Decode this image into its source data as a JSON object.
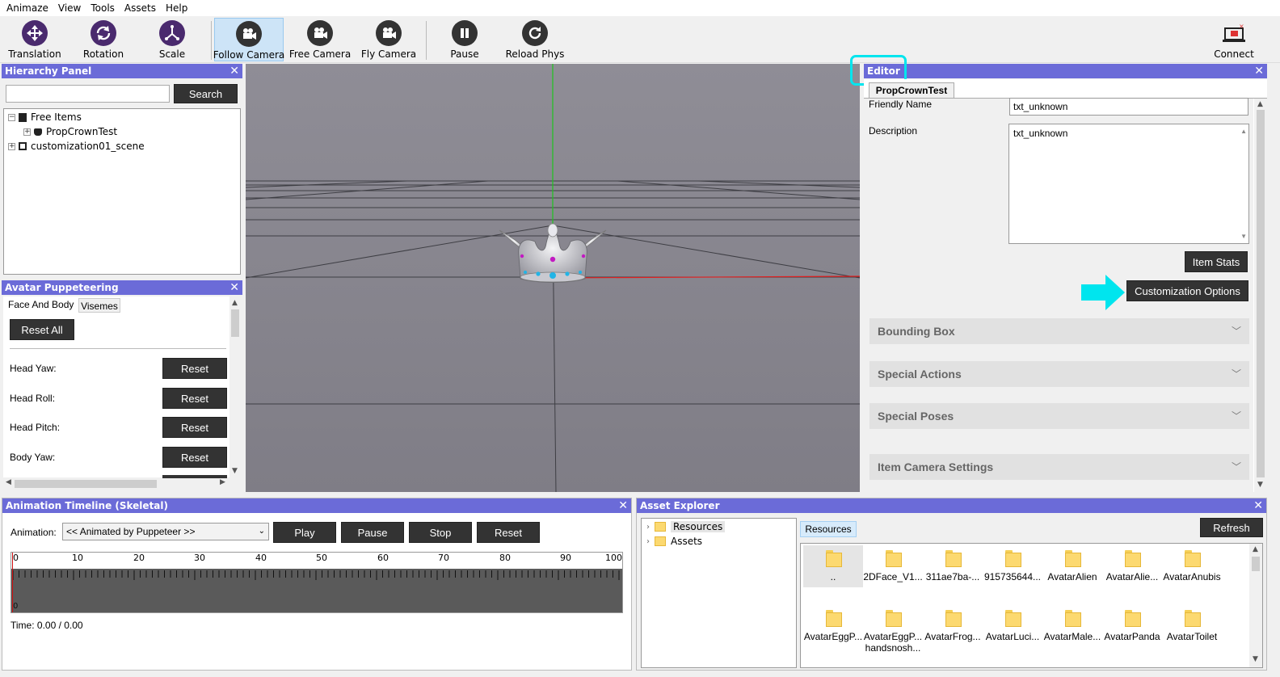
{
  "menu": [
    "Animaze",
    "View",
    "Tools",
    "Assets",
    "Help"
  ],
  "toolbar": {
    "translation": "Translation",
    "rotation": "Rotation",
    "scale": "Scale",
    "follow_camera": "Follow Camera",
    "free_camera": "Free Camera",
    "fly_camera": "Fly Camera",
    "pause": "Pause",
    "reload_phys": "Reload Phys",
    "connect": "Connect"
  },
  "hierarchy": {
    "title": "Hierarchy Panel",
    "search_label": "Search",
    "search_value": "",
    "items": [
      "Free Items",
      "PropCrownTest",
      "customization01_scene"
    ]
  },
  "puppeteering": {
    "title": "Avatar Puppeteering",
    "tabs": [
      "Face And Body",
      "Visemes"
    ],
    "reset_all": "Reset All",
    "rows": [
      {
        "label": "Head Yaw:",
        "button": "Reset"
      },
      {
        "label": "Head Roll:",
        "button": "Reset"
      },
      {
        "label": "Head Pitch:",
        "button": "Reset"
      },
      {
        "label": "Body Yaw:",
        "button": "Reset"
      }
    ]
  },
  "editor": {
    "title": "Editor",
    "tab": "PropCrownTest",
    "friendly_name_label": "Friendly Name",
    "friendly_name_value": "txt_unknown",
    "description_label": "Description",
    "description_value": "txt_unknown",
    "item_stats": "Item Stats",
    "customization_options": "Customization Options",
    "sections": [
      "Bounding Box",
      "Special Actions",
      "Special Poses",
      "Item Camera Settings"
    ]
  },
  "timeline": {
    "title": "Animation Timeline (Skeletal)",
    "animation_label": "Animation:",
    "animation_value": "<< Animated by Puppeteer >>",
    "play": "Play",
    "pause": "Pause",
    "stop": "Stop",
    "reset": "Reset",
    "ticks": [
      "0",
      "10",
      "20",
      "30",
      "40",
      "50",
      "60",
      "70",
      "80",
      "90",
      "100"
    ],
    "zero_marker": "0",
    "time_text": "Time: 0.00 / 0.00"
  },
  "assets": {
    "title": "Asset Explorer",
    "tree": [
      "Resources",
      "Assets"
    ],
    "breadcrumb": "Resources",
    "refresh": "Refresh",
    "items": [
      {
        "name": ".."
      },
      {
        "name": "2DFace_V1..."
      },
      {
        "name": "311ae7ba-..."
      },
      {
        "name": "915735644..."
      },
      {
        "name": "AvatarAlien"
      },
      {
        "name": "AvatarAlie..."
      },
      {
        "name": "AvatarAnubis"
      },
      {
        "name": "AvatarEggP..."
      },
      {
        "name": "AvatarEggP...",
        "name2": "handsnosh..."
      },
      {
        "name": "AvatarFrog..."
      },
      {
        "name": "AvatarLuci..."
      },
      {
        "name": "AvatarMale..."
      },
      {
        "name": "AvatarPanda"
      },
      {
        "name": "AvatarToilet"
      }
    ]
  },
  "colors": {
    "panel_header": "#6b6bd8",
    "toolbar_icon": "#4a2a6e",
    "camera_icon": "#333333",
    "highlight": "#00e5ee",
    "viewport": "#8a8891"
  }
}
